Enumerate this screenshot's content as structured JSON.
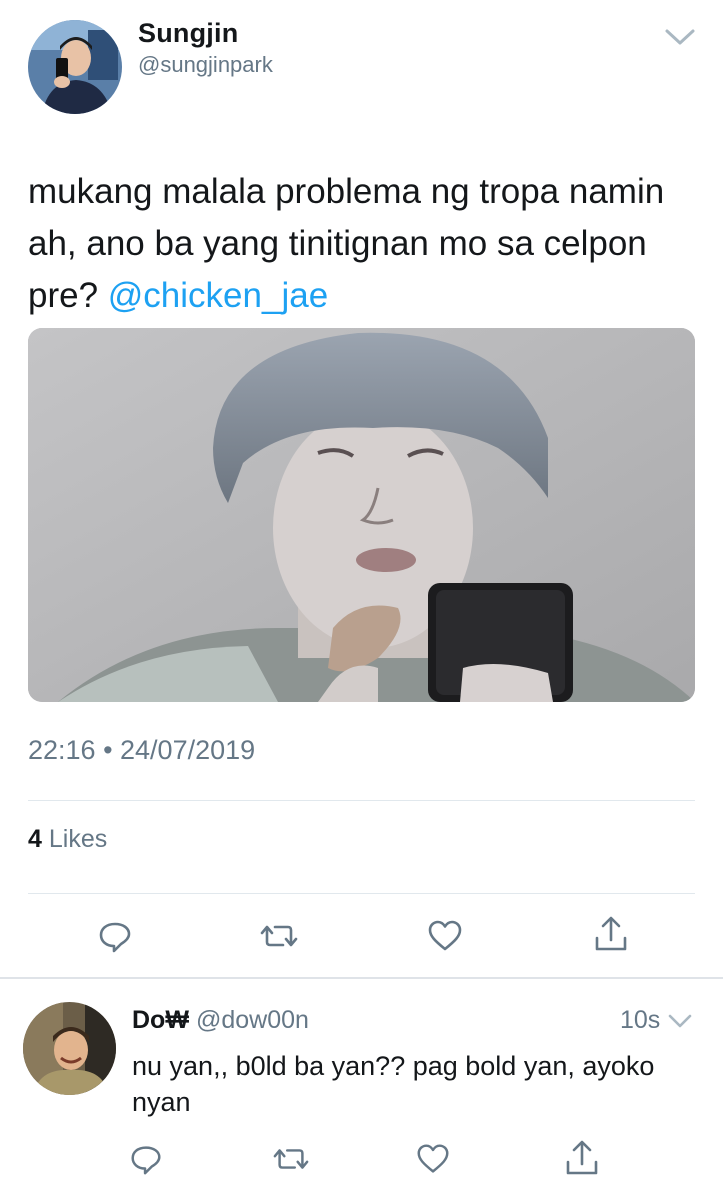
{
  "tweet": {
    "author_name": "Sungjin",
    "author_handle": "@sungjinpark",
    "text_before_mention": "mukang malala problema ng tropa namin ah, ano ba yang tinitignan mo sa celpon pre? ",
    "mention": "@chicken_jae",
    "timestamp": "22:16 • 24/07/2019",
    "likes_count": "4",
    "likes_label": "Likes",
    "actions": {
      "reply_icon": "reply-icon",
      "retweet_icon": "retweet-icon",
      "like_icon": "heart-icon",
      "share_icon": "share-icon"
    }
  },
  "reply": {
    "author_name": "Do₩",
    "author_handle": "@dow00n",
    "time": "10s",
    "text": "nu yan,, b0ld ba yan?? pag bold yan, ayoko nyan"
  },
  "colors": {
    "mention": "#1da1f2",
    "secondary_text": "#657786",
    "divider": "#e1e8ed"
  }
}
